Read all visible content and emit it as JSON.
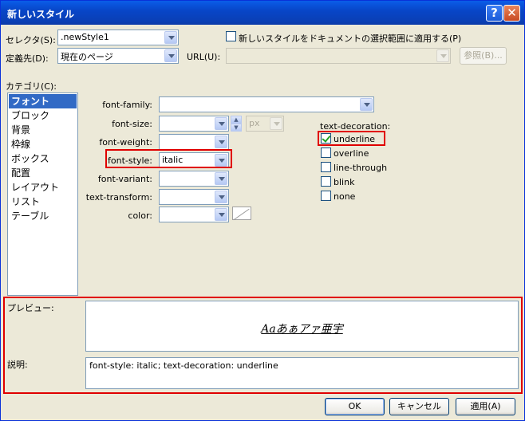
{
  "window": {
    "title": "新しいスタイル",
    "help_glyph": "?",
    "close_glyph": "✕"
  },
  "top": {
    "selector_label": "セレクタ(S):",
    "selector_value": ".newStyle1",
    "apply_doc_label": "新しいスタイルをドキュメントの選択範囲に適用する(P)",
    "define_in_label": "定義先(D):",
    "define_in_value": "現在のページ",
    "url_label": "URL(U):",
    "url_value": "",
    "browse_label": "参照(B)..."
  },
  "category": {
    "label": "カテゴリ(C):",
    "items": [
      "フォント",
      "ブロック",
      "背景",
      "枠線",
      "ボックス",
      "配置",
      "レイアウト",
      "リスト",
      "テーブル"
    ],
    "selected_index": 0
  },
  "font": {
    "family_label": "font-family:",
    "family_value": "",
    "size_label": "font-size:",
    "size_value": "",
    "size_unit": "px",
    "weight_label": "font-weight:",
    "weight_value": "",
    "style_label": "font-style:",
    "style_value": "italic",
    "variant_label": "font-variant:",
    "variant_value": "",
    "transform_label": "text-transform:",
    "transform_value": "",
    "color_label": "color:",
    "color_value": ""
  },
  "decoration": {
    "label": "text-decoration:",
    "options": [
      {
        "label": "underline",
        "checked": true
      },
      {
        "label": "overline",
        "checked": false
      },
      {
        "label": "line-through",
        "checked": false
      },
      {
        "label": "blink",
        "checked": false
      },
      {
        "label": "none",
        "checked": false
      }
    ]
  },
  "preview": {
    "label": "プレビュー:",
    "sample": "Aaあぁアァ亜宇"
  },
  "description": {
    "label": "説明:",
    "text": "font-style: italic; text-decoration: underline"
  },
  "buttons": {
    "ok": "OK",
    "cancel": "キャンセル",
    "apply": "適用(A)"
  },
  "colors": {
    "highlight_border": "#e00000",
    "selection": "#316ac5",
    "titlebar": "#0846c8"
  }
}
